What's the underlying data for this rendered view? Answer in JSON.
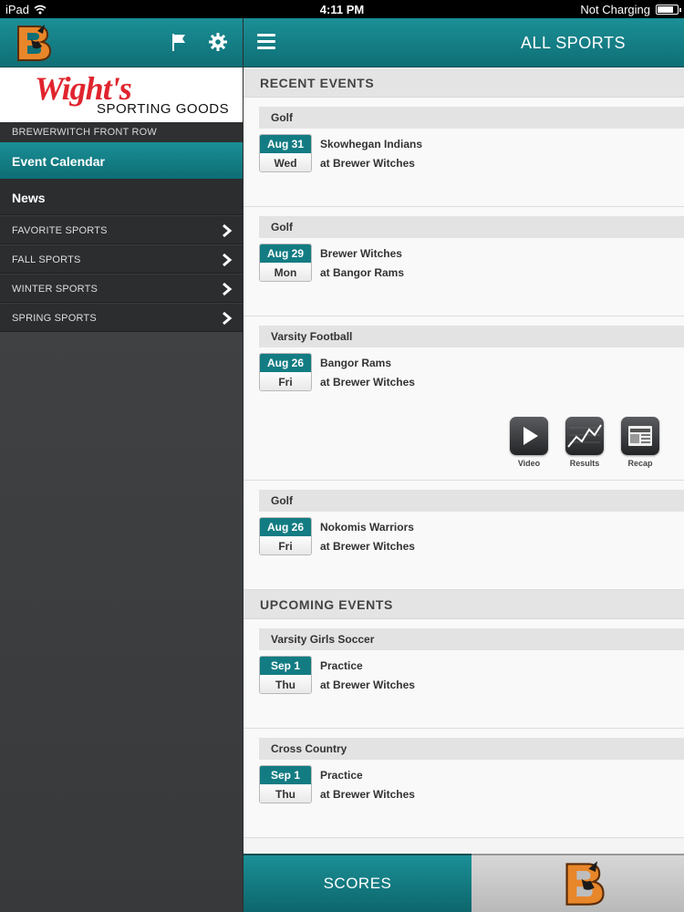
{
  "status_bar": {
    "device": "iPad",
    "time": "4:11 PM",
    "charging": "Not Charging",
    "battery_level": 0.8
  },
  "sidebar": {
    "logo_icon": "brewer-witch-b-logo",
    "flag_icon": "flag-icon",
    "gear_icon": "gear-icon",
    "sponsor": {
      "brand": "Wight's",
      "sub": "SPORTING GOODS"
    },
    "section_label": "BREWERWITCH FRONT ROW",
    "active_item": "Event Calendar",
    "news_item": "News",
    "categories": [
      "FAVORITE SPORTS",
      "FALL SPORTS",
      "WINTER SPORTS",
      "SPRING SPORTS"
    ]
  },
  "main": {
    "title": "ALL SPORTS",
    "recent_heading": "RECENT EVENTS",
    "upcoming_heading": "UPCOMING EVENTS",
    "recent_events": [
      {
        "sport": "Golf",
        "date": "Aug 31",
        "day": "Wed",
        "team": "Skowhegan Indians",
        "location": "at Brewer Witches"
      },
      {
        "sport": "Golf",
        "date": "Aug 29",
        "day": "Mon",
        "team": "Brewer Witches",
        "location": "at Bangor Rams"
      },
      {
        "sport": "Varsity Football",
        "date": "Aug 26",
        "day": "Fri",
        "team": "Bangor Rams",
        "location": "at Brewer Witches",
        "media": [
          {
            "label": "Video",
            "icon": "play-icon"
          },
          {
            "label": "Results",
            "icon": "chart-icon"
          },
          {
            "label": "Recap",
            "icon": "newspaper-icon"
          }
        ]
      },
      {
        "sport": "Golf",
        "date": "Aug 26",
        "day": "Fri",
        "team": "Nokomis Warriors",
        "location": "at Brewer Witches"
      }
    ],
    "upcoming_events": [
      {
        "sport": "Varsity Girls Soccer",
        "date": "Sep 1",
        "day": "Thu",
        "team": "Practice",
        "location": "at Brewer Witches"
      },
      {
        "sport": "Cross Country",
        "date": "Sep 1",
        "day": "Thu",
        "team": "Practice",
        "location": "at Brewer Witches"
      }
    ]
  },
  "tabs": {
    "scores": "SCORES",
    "home_icon": "brewer-witch-b-logo"
  },
  "colors": {
    "teal": "#137c83",
    "teal_light": "#1b8f96",
    "logo_orange": "#e8862a"
  }
}
